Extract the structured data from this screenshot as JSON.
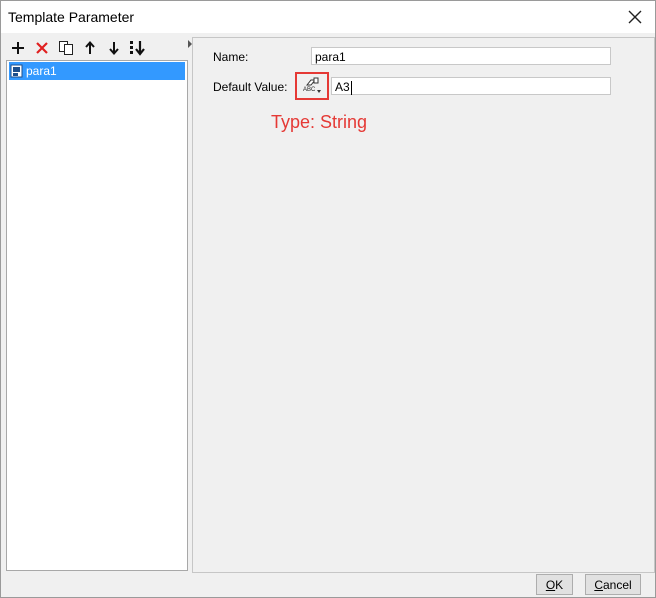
{
  "window": {
    "title": "Template Parameter"
  },
  "toolbar": {
    "buttons": [
      {
        "name": "add",
        "icon": "plus-icon"
      },
      {
        "name": "delete",
        "icon": "delete-x-icon"
      },
      {
        "name": "copy",
        "icon": "copy-icon"
      },
      {
        "name": "move-up",
        "icon": "arrow-up-icon"
      },
      {
        "name": "move-down",
        "icon": "arrow-down-icon"
      },
      {
        "name": "import",
        "icon": "import-icon"
      }
    ]
  },
  "tree": {
    "items": [
      {
        "label": "para1",
        "selected": true
      }
    ]
  },
  "form": {
    "name_label": "Name:",
    "name_value": "para1",
    "default_label": "Default Value:",
    "default_value": "A3",
    "type_icon": "string-type-icon"
  },
  "annotation": {
    "text": "Type: String",
    "color": "#e53935"
  },
  "buttons": {
    "ok_mnemonic": "O",
    "ok_rest": "K",
    "cancel_mnemonic": "C",
    "cancel_rest": "ancel"
  },
  "colors": {
    "selection": "#3399ff",
    "accent_red": "#e53935"
  }
}
